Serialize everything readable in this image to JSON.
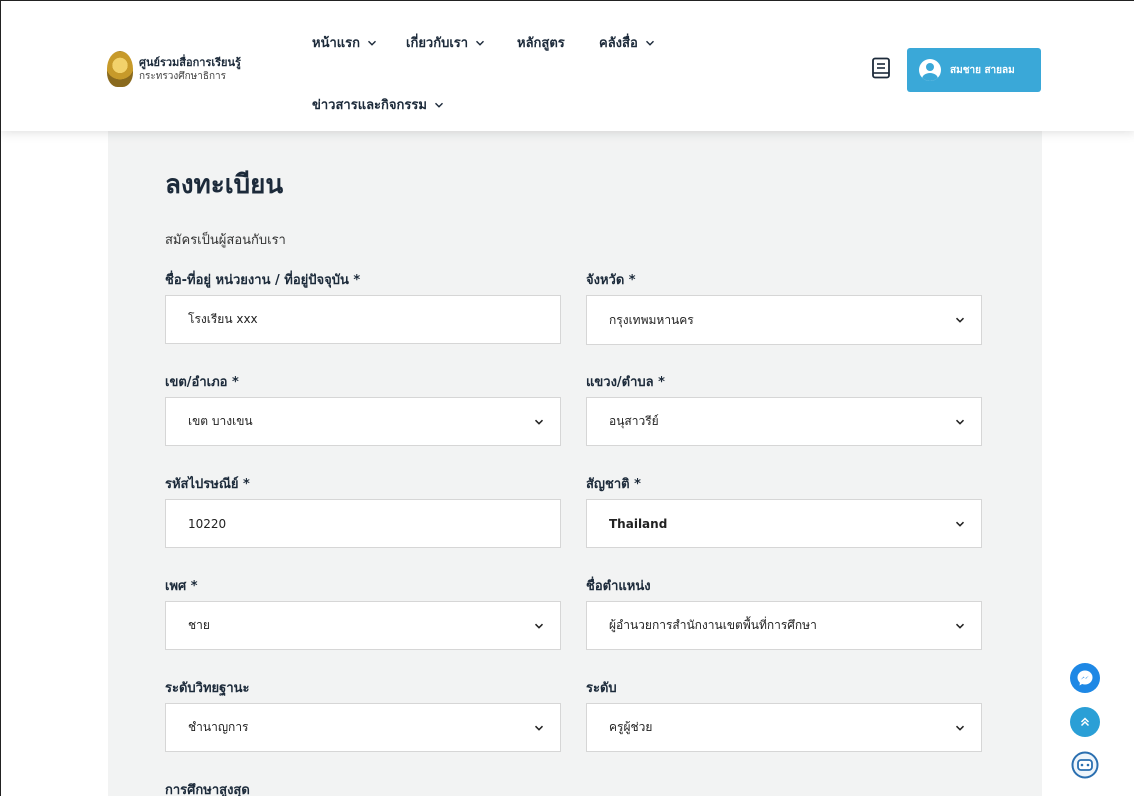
{
  "brand": {
    "line1": "ศูนย์รวมสื่อการเรียนรู้",
    "line2": "กระทรวงศึกษาธิการ"
  },
  "nav": {
    "home": "หน้าแรก",
    "about": "เกี่ยวกับเรา",
    "courses": "หลักสูตร",
    "library": "คลังสื่อ",
    "news": "ข่าวสารและกิจกรรม"
  },
  "user": {
    "name": "สมชาย สายลม"
  },
  "form": {
    "title": "ลงทะเบียน",
    "subtitle": "สมัครเป็นผู้สอนกับเรา",
    "fields": {
      "address": {
        "label": "ชื่อ-ที่อยู่ หน่วยงาน / ที่อยู่ปัจจุบัน *",
        "value": "โรงเรียน xxx"
      },
      "province": {
        "label": "จังหวัด *",
        "value": "กรุงเทพมหานคร"
      },
      "district": {
        "label": "เขต/อำเภอ *",
        "value": "เขต บางเขน"
      },
      "subdistrict": {
        "label": "แขวง/ตำบล *",
        "value": "อนุสาวรีย์"
      },
      "postcode": {
        "label": "รหัสไปรษณีย์ *",
        "value": "10220"
      },
      "nationality": {
        "label": "สัญชาติ *",
        "value": "Thailand"
      },
      "gender": {
        "label": "เพศ *",
        "value": "ชาย"
      },
      "position": {
        "label": "ชื่อตำแหน่ง",
        "value": "ผู้อำนวยการสำนักงานเขตพื้นที่การศึกษา"
      },
      "academic_rank": {
        "label": "ระดับวิทยฐานะ",
        "value": "ชำนาญการ"
      },
      "level": {
        "label": "ระดับ",
        "value": "ครูผู้ช่วย"
      },
      "education": {
        "label": "การศึกษาสูงสุด"
      }
    }
  },
  "icons": [
    "book-icon",
    "user-avatar-icon",
    "chevron-down-icon",
    "messenger-icon",
    "scroll-top-icon",
    "chatbot-icon"
  ],
  "colors": {
    "accent": "#3aa8d8",
    "panel": "#f2f3f3",
    "text": "#1c2a3a",
    "messenger": "#1e88e5",
    "scroll_top": "#2a9fd6"
  }
}
